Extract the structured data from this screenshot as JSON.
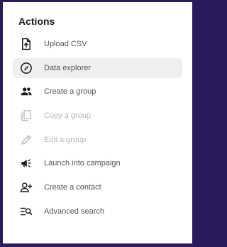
{
  "panel": {
    "title": "Actions",
    "items": [
      {
        "label": "Upload CSV",
        "icon": "upload-file-icon",
        "enabled": true,
        "selected": false
      },
      {
        "label": "Data explorer",
        "icon": "compass-icon",
        "enabled": true,
        "selected": true
      },
      {
        "label": "Create a group",
        "icon": "group-icon",
        "enabled": true,
        "selected": false
      },
      {
        "label": "Copy a group",
        "icon": "copy-icon",
        "enabled": false,
        "selected": false
      },
      {
        "label": "Edit a group",
        "icon": "pencil-icon",
        "enabled": false,
        "selected": false
      },
      {
        "label": "Launch into campaign",
        "icon": "campaign-megaphone-icon",
        "enabled": true,
        "selected": false
      },
      {
        "label": "Create a contact",
        "icon": "add-person-icon",
        "enabled": true,
        "selected": false
      },
      {
        "label": "Advanced search",
        "icon": "advanced-search-icon",
        "enabled": true,
        "selected": false
      }
    ]
  },
  "colors": {
    "frame_border": "#2b1a5c",
    "selected_bg": "#efefef",
    "icon_enabled": "#1b1b1b",
    "icon_disabled": "#b7b7b7"
  }
}
